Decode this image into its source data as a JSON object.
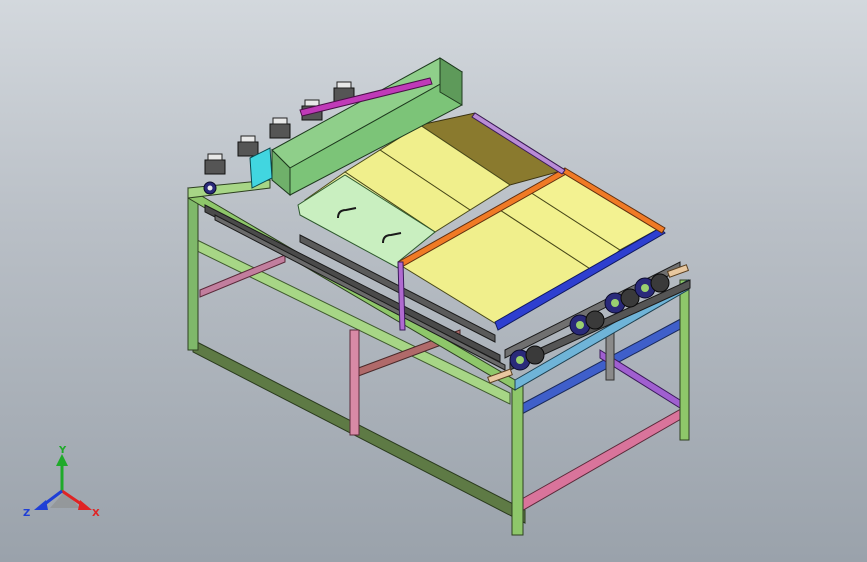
{
  "viewport": {
    "background_top": "#d3d8dd",
    "background_bottom": "#9aa2ab"
  },
  "triad": {
    "x_label": "X",
    "y_label": "Y",
    "z_label": "Z",
    "x_color": "#e02424",
    "y_color": "#1faa2a",
    "z_color": "#1f3fd6"
  },
  "model": {
    "frame_colors": [
      "#7fb86a",
      "#b27aa0",
      "#8ec76a",
      "#6f8b4e",
      "#3d61c9",
      "#c76b8c",
      "#a66cc0"
    ],
    "deck_yellow": "#f0ef8c",
    "hood_green": "#8fcf8a",
    "rail_blue": "#2e3fd0",
    "rail_orange": "#f07a25",
    "rail_purple": "#b98bd6",
    "dark_panel": "#8a7a2e"
  }
}
